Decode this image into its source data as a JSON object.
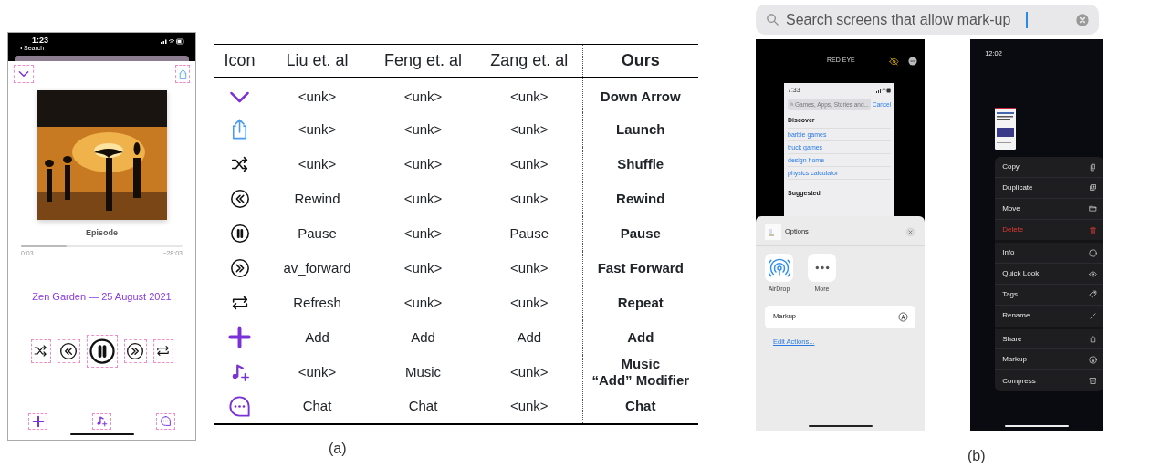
{
  "figure_a": {
    "phone": {
      "status": {
        "time": "1:23",
        "back": "Search"
      },
      "top_buttons": [
        {
          "kind": "chevron-down"
        },
        {
          "kind": "share"
        }
      ],
      "episode_title": "Episode",
      "progress": {
        "level": 0.28,
        "elapsed": "0:03",
        "remaining": "−28:03"
      },
      "show_title": "Zen Garden — 25 August 2021",
      "controls": [
        {
          "kind": "shuffle"
        },
        {
          "kind": "rewind"
        },
        {
          "kind": "pause"
        },
        {
          "kind": "forward"
        },
        {
          "kind": "repeat"
        }
      ],
      "toolbar": [
        {
          "kind": "plus"
        },
        {
          "kind": "music-add"
        },
        {
          "kind": "chat"
        }
      ]
    },
    "table": {
      "icon_header": "Icon",
      "columns": [
        "Liu et. al",
        "Feng et. al",
        "Zang et. al",
        "Ours"
      ],
      "rows": [
        {
          "kind": "chevron-down",
          "cells": [
            "<unk>",
            "<unk>",
            "<unk>",
            "Down Arrow"
          ]
        },
        {
          "kind": "share",
          "cells": [
            "<unk>",
            "<unk>",
            "<unk>",
            "Launch"
          ]
        },
        {
          "kind": "shuffle",
          "cells": [
            "<unk>",
            "<unk>",
            "<unk>",
            "Shuffle"
          ]
        },
        {
          "kind": "rewind",
          "cells": [
            "Rewind",
            "<unk>",
            "<unk>",
            "Rewind"
          ]
        },
        {
          "kind": "pause",
          "cells": [
            "Pause",
            "<unk>",
            "Pause",
            "Pause"
          ]
        },
        {
          "kind": "forward",
          "cells": [
            "av_forward",
            "<unk>",
            "<unk>",
            "Fast Forward"
          ]
        },
        {
          "kind": "repeat",
          "cells": [
            "Refresh",
            "<unk>",
            "<unk>",
            "Repeat"
          ]
        },
        {
          "kind": "plus",
          "cells": [
            "Add",
            "Add",
            "Add",
            "Add"
          ]
        },
        {
          "kind": "music-add",
          "cells": [
            "<unk>",
            "Music",
            "<unk>",
            "Music\n“Add” Modifier"
          ]
        },
        {
          "kind": "chat",
          "cells": [
            "Chat",
            "Chat",
            "<unk>",
            "Chat"
          ]
        }
      ]
    },
    "caption": "(a)"
  },
  "figure_b": {
    "search": {
      "value": "Search screens that allow mark-up"
    },
    "screen_1": {
      "title": "RED EYE",
      "inner": {
        "time": "7:33",
        "search_placeholder": "Games, Apps, Stories and...",
        "cancel": "Cancel",
        "discover_heading": "Discover",
        "links": [
          "barbie games",
          "truck games",
          "design home",
          "physics calculator"
        ],
        "suggested_heading": "Suggested"
      },
      "sheet": {
        "title": "Options",
        "apps": [
          {
            "kind": "airdrop",
            "label": "AirDrop"
          },
          {
            "kind": "more",
            "label": "More"
          }
        ],
        "actions": [
          {
            "label": "Markup",
            "kind": "markup"
          }
        ],
        "edit_link": "Edit Actions..."
      }
    },
    "screen_2": {
      "time": "12:02",
      "menu": [
        {
          "items": [
            {
              "label": "Copy",
              "kind": "copy",
              "destructive": false
            },
            {
              "label": "Duplicate",
              "kind": "duplicate",
              "destructive": false
            },
            {
              "label": "Move",
              "kind": "folder",
              "destructive": false
            },
            {
              "label": "Delete",
              "kind": "trash",
              "destructive": true
            }
          ]
        },
        {
          "items": [
            {
              "label": "Info",
              "kind": "info",
              "destructive": false
            },
            {
              "label": "Quick Look",
              "kind": "eye",
              "destructive": false
            },
            {
              "label": "Tags",
              "kind": "tag",
              "destructive": false
            },
            {
              "label": "Rename",
              "kind": "pencil",
              "destructive": false
            }
          ]
        },
        {
          "items": [
            {
              "label": "Share",
              "kind": "share",
              "destructive": false
            },
            {
              "label": "Markup",
              "kind": "markup",
              "destructive": false
            },
            {
              "label": "Compress",
              "kind": "archive",
              "destructive": false
            }
          ]
        }
      ]
    },
    "caption": "(b)"
  }
}
